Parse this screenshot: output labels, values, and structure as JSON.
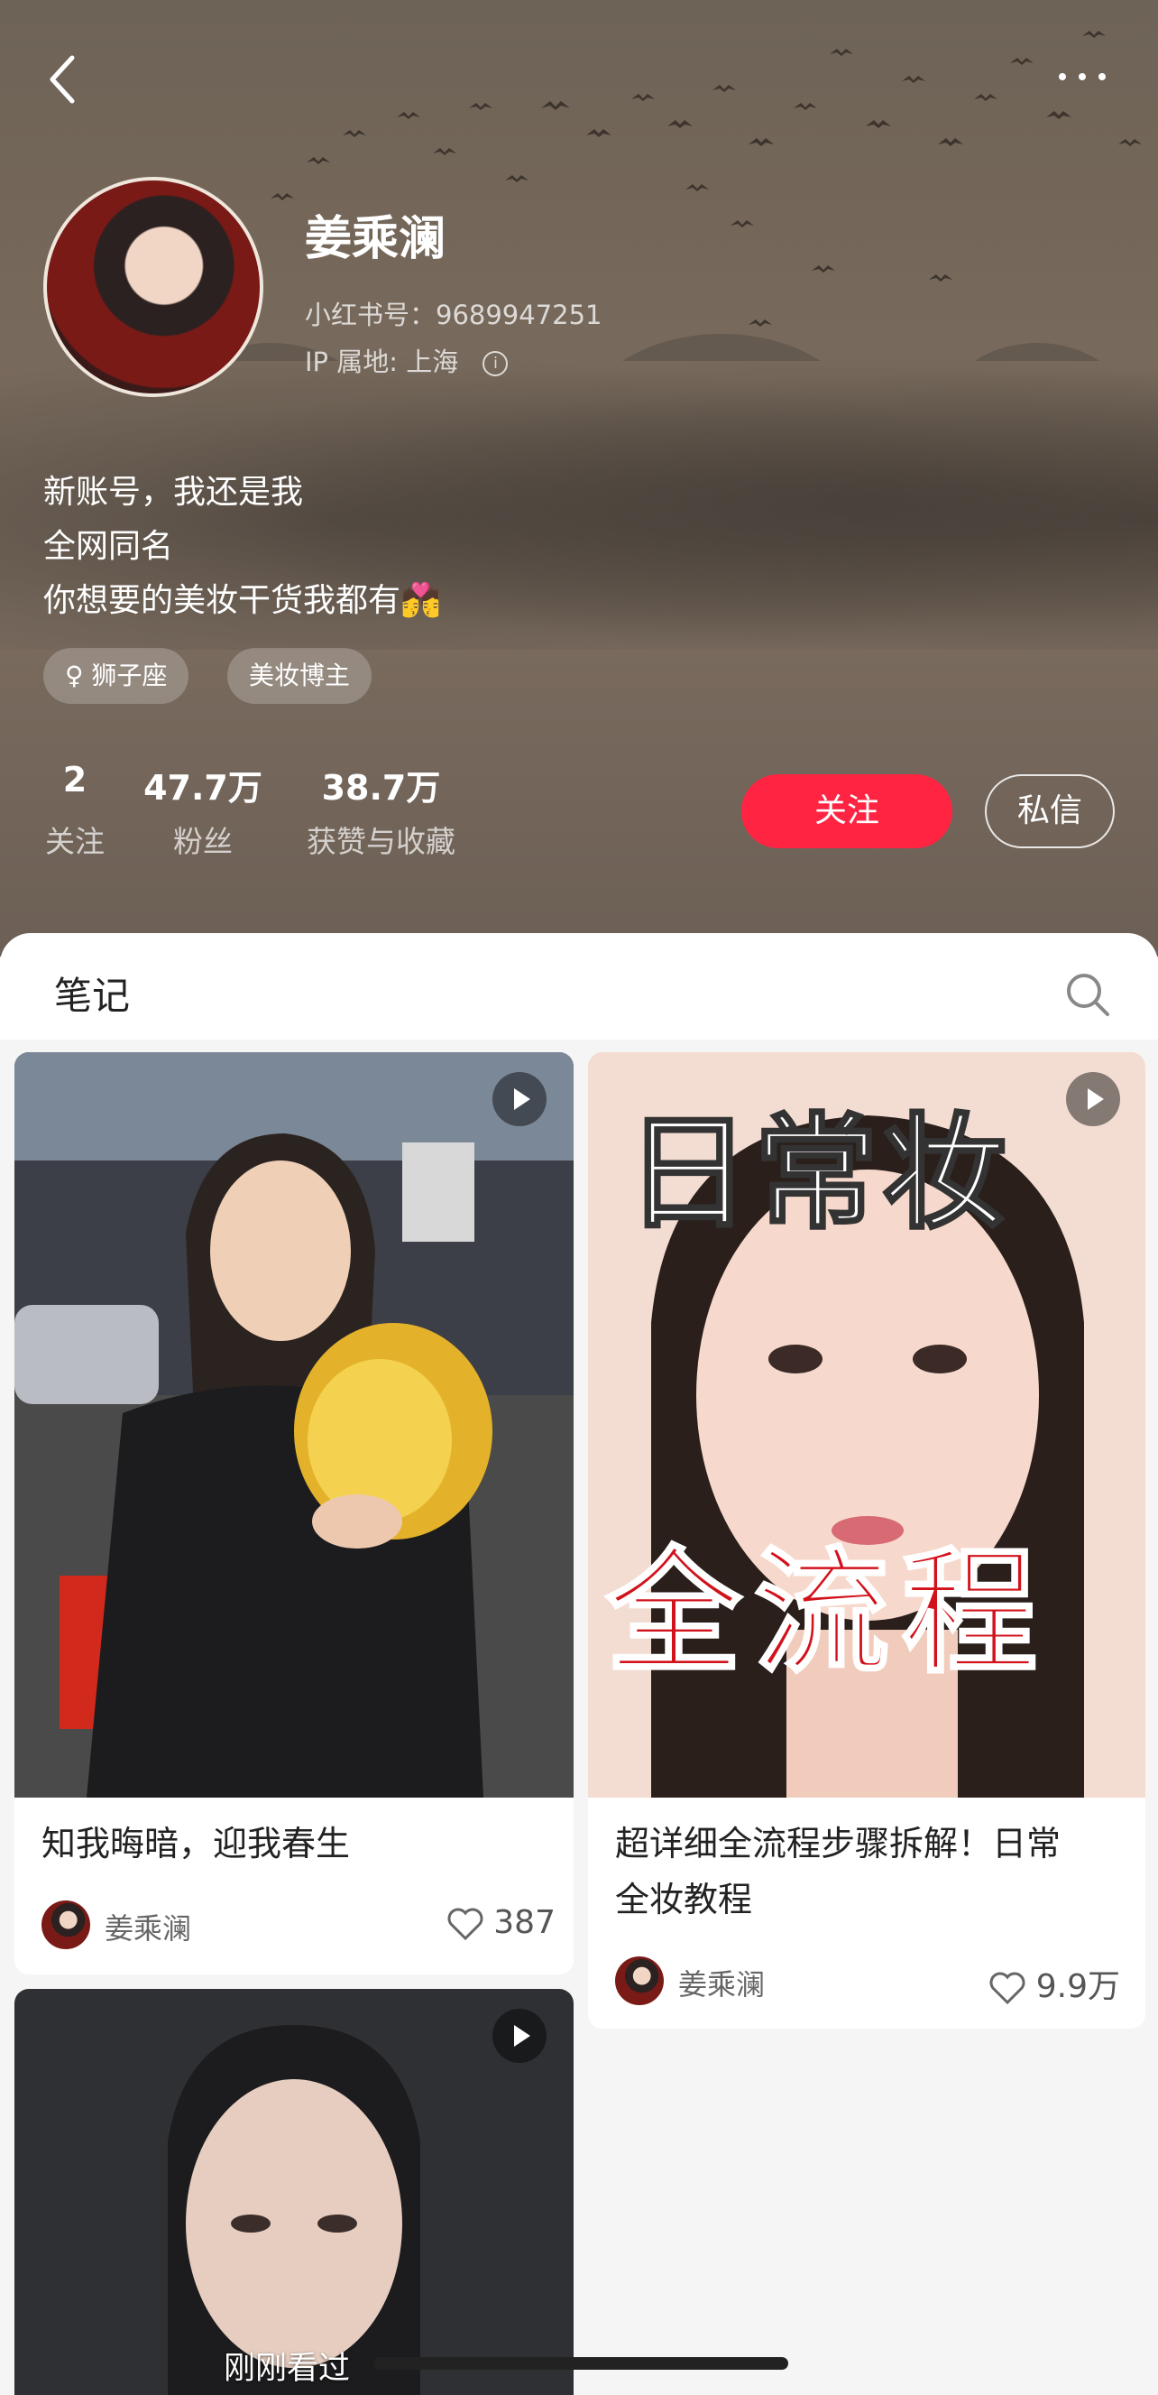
{
  "profile": {
    "name": "姜乘澜",
    "red_id": "小红书号：9689947251",
    "ip_location": "IP 属地: 上海",
    "bio_lines": [
      "新账号，我还是我",
      "全网同名",
      "你想要的美妆干货我都有💏"
    ],
    "tags": [
      "♀ 狮子座",
      "美妆博主"
    ],
    "stats": [
      {
        "value": "2",
        "label": "关注"
      },
      {
        "value": "47.7万",
        "label": "粉丝"
      },
      {
        "value": "38.7万",
        "label": "获赞与收藏"
      }
    ],
    "follow_label": "关注",
    "message_label": "私信"
  },
  "notes": {
    "title": "笔记",
    "items": [
      {
        "title": "知我晦暗，迎我春生",
        "author": "姜乘澜",
        "likes": "387"
      },
      {
        "title_line1": "超详细全流程步骤拆解！日常",
        "title_line2": "全妆教程",
        "author": "姜乘澜",
        "likes": "9.9万",
        "cover_text_top": "日常妆",
        "cover_text_bottom": "全流程"
      }
    ]
  },
  "footer": {
    "recent_label": "刚刚看过"
  },
  "colors": {
    "accent": "#ff2442",
    "header_bg": "#77695b"
  },
  "icons": [
    "back-chevron-icon",
    "more-dots-icon",
    "info-icon",
    "search-icon",
    "play-icon",
    "heart-icon"
  ]
}
